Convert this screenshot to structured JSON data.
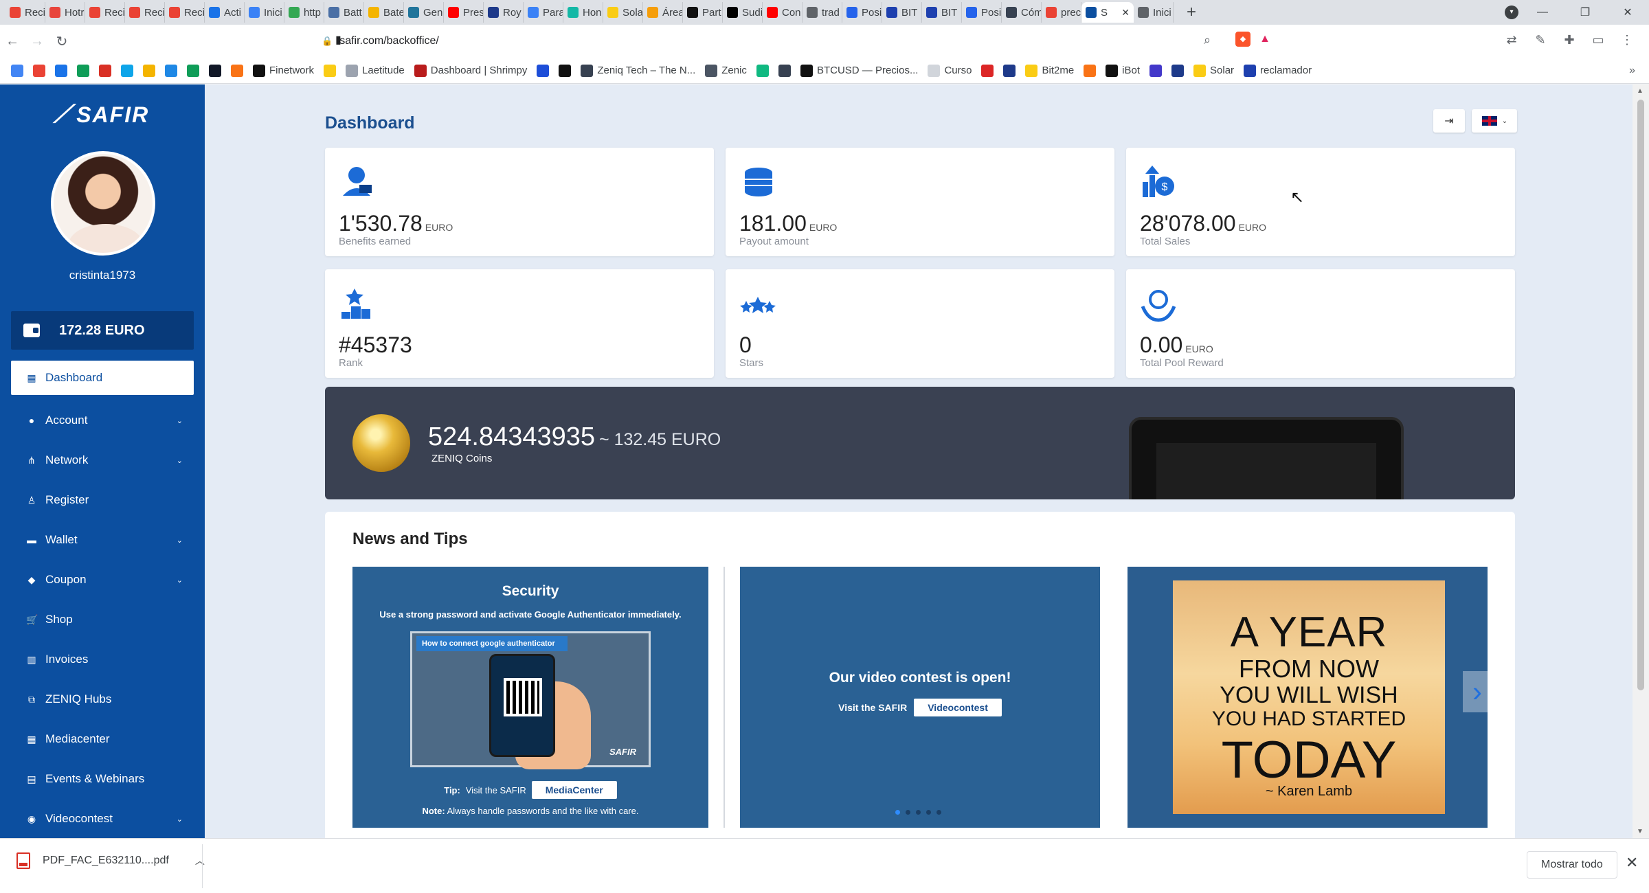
{
  "browser": {
    "tabs": [
      {
        "label": "Recil",
        "color": "#ea4335"
      },
      {
        "label": "Hotr",
        "color": "#e8453c"
      },
      {
        "label": "Recil",
        "color": "#ea4335"
      },
      {
        "label": "Recil",
        "color": "#ea4335"
      },
      {
        "label": "Recil",
        "color": "#ea4335"
      },
      {
        "label": "Acti",
        "color": "#1a73e8"
      },
      {
        "label": "Inici",
        "color": "#3b82f6"
      },
      {
        "label": "http",
        "color": "#34a853"
      },
      {
        "label": "Batt",
        "color": "#4a6fa5"
      },
      {
        "label": "Bate",
        "color": "#f4b400"
      },
      {
        "label": "Gen",
        "color": "#21759b"
      },
      {
        "label": "Pres",
        "color": "#ff0000"
      },
      {
        "label": "Roy",
        "color": "#1e3a8a"
      },
      {
        "label": "Para",
        "color": "#3b82f6"
      },
      {
        "label": "Hon",
        "color": "#14b8a6"
      },
      {
        "label": "Sola",
        "color": "#facc15"
      },
      {
        "label": "Área",
        "color": "#f59e0b"
      },
      {
        "label": "Part",
        "color": "#111111"
      },
      {
        "label": "Sudi",
        "color": "#000000"
      },
      {
        "label": "Con",
        "color": "#ff0000"
      },
      {
        "label": "trad",
        "color": "#5f6368"
      },
      {
        "label": "Posi",
        "color": "#2563eb"
      },
      {
        "label": "BIT",
        "color": "#1e40af"
      },
      {
        "label": "BIT",
        "color": "#1e40af"
      },
      {
        "label": "Posi",
        "color": "#2563eb"
      },
      {
        "label": "Cóm",
        "color": "#374151"
      },
      {
        "label": "prec",
        "color": "#ea4335"
      },
      {
        "label": "S",
        "color": "#0c4fa0"
      },
      {
        "label": "Inici",
        "color": "#5f6368"
      }
    ],
    "new_tab": "+",
    "tab_close": "✕",
    "window": {
      "minimize": "—",
      "maximize": "❐",
      "close": "✕"
    },
    "url": "safir.com/backoffice/",
    "bookmarks": [
      {
        "label": "",
        "color": "#4285f4"
      },
      {
        "label": "",
        "color": "#ea4335"
      },
      {
        "label": "",
        "color": "#1a73e8"
      },
      {
        "label": "",
        "color": "#0f9d58"
      },
      {
        "label": "",
        "color": "#d93025"
      },
      {
        "label": "",
        "color": "#0ea5e9"
      },
      {
        "label": "",
        "color": "#f4b400"
      },
      {
        "label": "",
        "color": "#1e88e5"
      },
      {
        "label": "",
        "color": "#0f9d58"
      },
      {
        "label": "",
        "color": "#111827"
      },
      {
        "label": "",
        "color": "#f97316"
      },
      {
        "label": "Finetwork",
        "color": "#111111"
      },
      {
        "label": "",
        "color": "#facc15"
      },
      {
        "label": "Laetitude",
        "color": "#9ca3af"
      },
      {
        "label": "Dashboard | Shrimpy",
        "color": "#b91c1c"
      },
      {
        "label": "",
        "color": "#1d4ed8"
      },
      {
        "label": "",
        "color": "#111111"
      },
      {
        "label": "Zeniq Tech – The N...",
        "color": "#374151"
      },
      {
        "label": "Zenic",
        "color": "#4b5563"
      },
      {
        "label": "",
        "color": "#10b981"
      },
      {
        "label": "",
        "color": "#374151"
      },
      {
        "label": "BTCUSD — Precios...",
        "color": "#111111"
      },
      {
        "label": "Curso",
        "color": "#d1d5db"
      },
      {
        "label": "",
        "color": "#dc2626"
      },
      {
        "label": "",
        "color": "#1e3a8a"
      },
      {
        "label": "Bit2me",
        "color": "#facc15"
      },
      {
        "label": "",
        "color": "#f97316"
      },
      {
        "label": "iBot",
        "color": "#111111"
      },
      {
        "label": "",
        "color": "#4338ca"
      },
      {
        "label": "",
        "color": "#1e3a8a"
      },
      {
        "label": "Solar",
        "color": "#facc15"
      },
      {
        "label": "reclamador",
        "color": "#1e40af"
      }
    ],
    "bookmarks_more": "»"
  },
  "sidebar": {
    "logo": "SAFIR",
    "username": "cristinta1973",
    "balance": "172.28 EURO",
    "items": [
      {
        "label": "Dashboard",
        "icon": "▦",
        "chevron": ""
      },
      {
        "label": "Account",
        "icon": "●",
        "chevron": "⌄"
      },
      {
        "label": "Network",
        "icon": "⋔",
        "chevron": "⌄"
      },
      {
        "label": "Register",
        "icon": "♙",
        "chevron": ""
      },
      {
        "label": "Wallet",
        "icon": "▬",
        "chevron": "⌄"
      },
      {
        "label": "Coupon",
        "icon": "◆",
        "chevron": "⌄"
      },
      {
        "label": "Shop",
        "icon": "🛒",
        "chevron": ""
      },
      {
        "label": "Invoices",
        "icon": "▥",
        "chevron": ""
      },
      {
        "label": "ZENIQ Hubs",
        "icon": "⧉",
        "chevron": ""
      },
      {
        "label": "Mediacenter",
        "icon": "▦",
        "chevron": ""
      },
      {
        "label": "Events & Webinars",
        "icon": "▤",
        "chevron": ""
      },
      {
        "label": "Videocontest",
        "icon": "◉",
        "chevron": "⌄"
      }
    ]
  },
  "main": {
    "title": "Dashboard",
    "stats": [
      {
        "value": "1'530.78",
        "unit": "EURO",
        "label": "Benefits earned",
        "icon": "user-money-icon"
      },
      {
        "value": "181.00",
        "unit": "EURO",
        "label": "Payout amount",
        "icon": "coins-stack-icon"
      },
      {
        "value": "28'078.00",
        "unit": "EURO",
        "label": "Total Sales",
        "icon": "sales-growth-icon"
      },
      {
        "value": "#45373",
        "unit": "",
        "label": "Rank",
        "icon": "podium-icon"
      },
      {
        "value": "0",
        "unit": "",
        "label": "Stars",
        "icon": "stars-icon"
      },
      {
        "value": "0.00",
        "unit": "EURO",
        "label": "Total Pool Reward",
        "icon": "reward-hands-icon"
      }
    ],
    "coins": {
      "amount": "524.84343935",
      "approx": "~ 132.45 EURO",
      "label": "ZENIQ Coins"
    },
    "news": {
      "title": "News and Tips",
      "security": {
        "title": "Security",
        "text": "Use a strong password and activate Google Authenticator",
        "text_bold": "immediately",
        "img_header": "How to connect google authenticator",
        "brand": "SAFIR",
        "tip_prefix": "Tip:",
        "tip_text": "Visit the SAFIR",
        "tip_button": "MediaCenter",
        "note_prefix": "Note:",
        "note_text": "Always handle passwords and the like with care."
      },
      "contest": {
        "title": "Our video contest is open!",
        "text": "Visit the SAFIR",
        "button": "Videocontest"
      },
      "quote": {
        "l1": "A YEAR",
        "l2": "FROM NOW",
        "l3": "YOU WILL WISH",
        "l4": "YOU HAD STARTED",
        "l5": "TODAY",
        "author": "~ Karen Lamb"
      }
    }
  },
  "downloads": {
    "file": "PDF_FAC_E632110....pdf",
    "show_all": "Mostrar todo"
  }
}
